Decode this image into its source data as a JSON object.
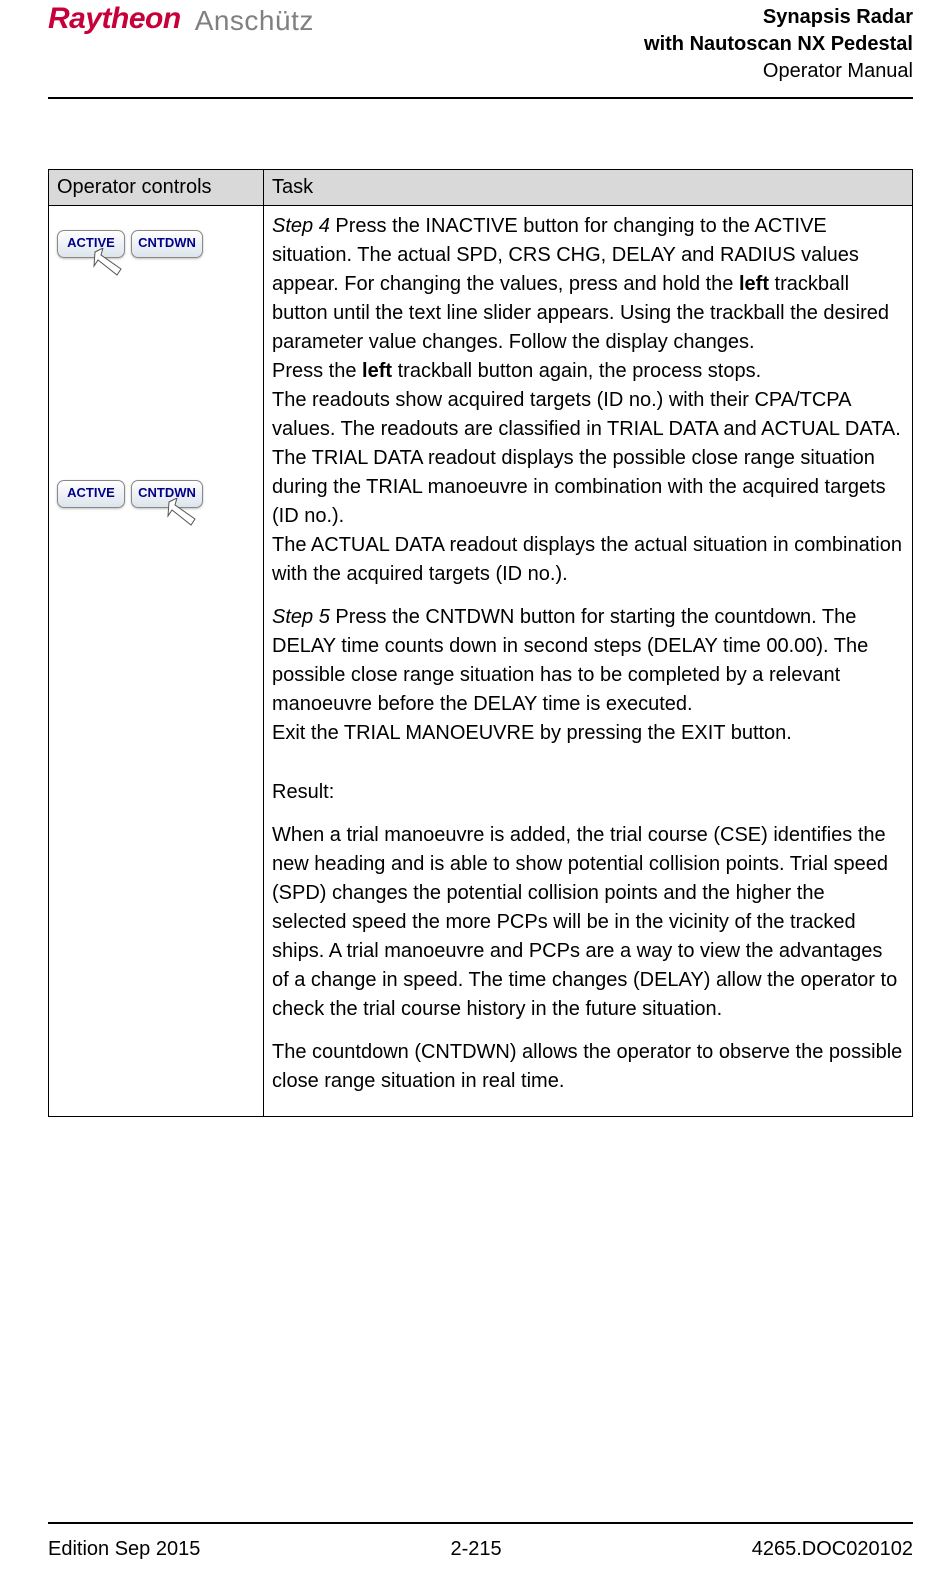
{
  "header": {
    "logo1": "Raytheon",
    "logo2": "Anschütz",
    "title1": "Synapsis Radar",
    "title2": "with Nautoscan NX Pedestal",
    "title3": "Operator Manual"
  },
  "table": {
    "col1": "Operator controls",
    "col2": "Task",
    "btn_active": "ACTIVE",
    "btn_cntdwn": "CNTDWN",
    "step4_label": "Step 4",
    "step4_a": "  Press the INACTIVE button for changing to the ACTIVE situation. The actual SPD, CRS CHG, DELAY and RADIUS values appear. For changing the values, press and hold the ",
    "left": "left",
    "step4_b": " trackball button until the text line slider appears. Using the trackball the desired parameter value changes. Follow the display changes.",
    "step4_c1": "Press the ",
    "step4_c2": " trackball button again, the process stops.",
    "step4_d": "The readouts show acquired targets (ID no.) with their CPA/TCPA values. The readouts are classified in TRIAL DATA and ACTUAL DATA.",
    "step4_e": "The TRIAL DATA readout displays the possible close range situation during the TRIAL manoeuvre in combination with the acquired targets (ID no.).",
    "step4_f": "The ACTUAL DATA readout displays the actual situation in combination with the acquired targets (ID no.).",
    "step5_label": "Step 5",
    "step5_a": " Press the CNTDWN button for starting the countdown. The DELAY time counts down in second steps (DELAY time 00.00). The possible close range situation has to be completed by a relevant manoeuvre before the DELAY time is executed.",
    "step5_b": "Exit the TRIAL MANOEUVRE by pressing the EXIT button.",
    "result_label": "Result:",
    "result_a": "When a trial manoeuvre is added, the trial course (CSE) identifies the new heading and is able to show potential collision points. Trial speed (SPD) changes the potential collision points and the higher the selected speed the more PCPs will be in the vicinity of the tracked ships. A trial manoeuvre and PCPs are a way to view the advantages of a change in speed. The time changes (DELAY) allow the operator to check the trial course history in the future situation.",
    "result_b": "The countdown (CNTDWN) allows the operator to observe the possible close range situation in real time."
  },
  "footer": {
    "left": "Edition Sep 2015",
    "center": "2-215",
    "right": "4265.DOC020102"
  }
}
